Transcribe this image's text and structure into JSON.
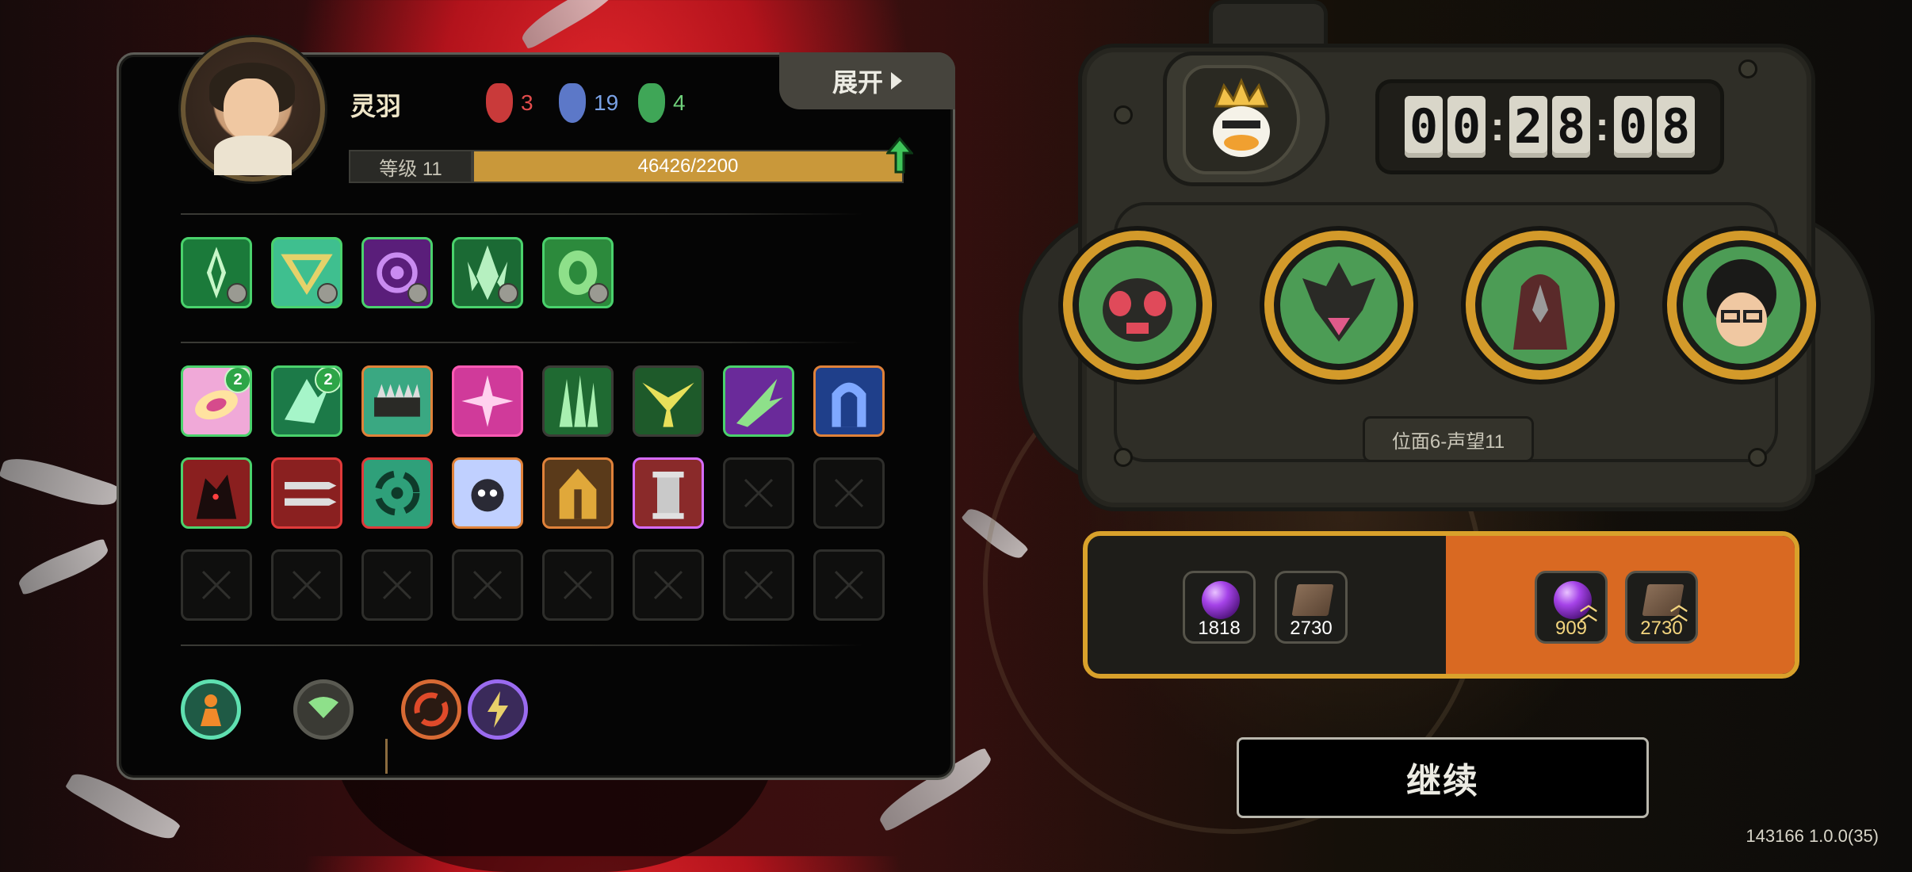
{
  "player": {
    "name": "灵羽",
    "avatar_icon": "player-portrait",
    "stats": [
      {
        "icon": "red-mask-icon",
        "value": "3",
        "color": "#e24c4c"
      },
      {
        "icon": "blue-mask-icon",
        "value": "19",
        "color": "#7aa2e6"
      },
      {
        "icon": "green-mask-icon",
        "value": "4",
        "color": "#6fd07a"
      }
    ],
    "expand_label": "展开",
    "level_label": "等级 11",
    "xp_text": "46426/2200",
    "xp_progress": 1.0
  },
  "skills": [
    "green-blade-skill",
    "teal-triangle-skill",
    "purple-swirl-skill",
    "green-crest-skill",
    "green-shield-skill"
  ],
  "items": {
    "row1": [
      {
        "icon": "pink-leaf-item",
        "border": "#4ad26c",
        "badge": "2"
      },
      {
        "icon": "teal-shard-item",
        "border": "#4ad26c",
        "badge": "2"
      },
      {
        "icon": "spike-trap-item",
        "border": "#e0823a",
        "badge": ""
      },
      {
        "icon": "pink-burst-item",
        "border": "#ff5ab4",
        "badge": ""
      },
      {
        "icon": "green-claw-item",
        "border": "#3c3c37",
        "badge": ""
      },
      {
        "icon": "yellow-wing-item",
        "border": "#3c3c37",
        "badge": ""
      },
      {
        "icon": "purple-blade-item",
        "border": "#4ad26c",
        "badge": ""
      },
      {
        "icon": "blue-arch-item",
        "border": "#e0823a",
        "badge": ""
      }
    ],
    "row2": [
      {
        "icon": "red-beast-item",
        "border": "#4ad26c"
      },
      {
        "icon": "twin-blade-item",
        "border": "#e03a3a"
      },
      {
        "icon": "teal-vortex-item",
        "border": "#e03a3a"
      },
      {
        "icon": "skull-burst-item",
        "border": "#e0823a"
      },
      {
        "icon": "golden-gate-item",
        "border": "#e0823a"
      },
      {
        "icon": "pillar-item",
        "border": "#d66bff"
      }
    ]
  },
  "relics": [
    "flame-figure-relic",
    "fan-relic",
    "red-spiral-relic",
    "lightning-relic"
  ],
  "console": {
    "timer": [
      "0",
      "0",
      "2",
      "8",
      "0",
      "8"
    ],
    "leader_icon": "crowned-duck-icon",
    "portraits": [
      "fly-enemy-portrait",
      "horned-demon-portrait",
      "hooded-bird-portrait",
      "curly-hair-portrait"
    ],
    "realm_label": "位面6-声望11"
  },
  "rewards": {
    "base": [
      {
        "icon": "purple-orb-icon",
        "value": "1818"
      },
      {
        "icon": "book-icon",
        "value": "2730"
      }
    ],
    "bonus": [
      {
        "icon": "purple-orb-up-icon",
        "value": "909"
      },
      {
        "icon": "book-up-icon",
        "value": "2730"
      }
    ]
  },
  "continue_label": "继续",
  "version": "143166 1.0.0(35)"
}
